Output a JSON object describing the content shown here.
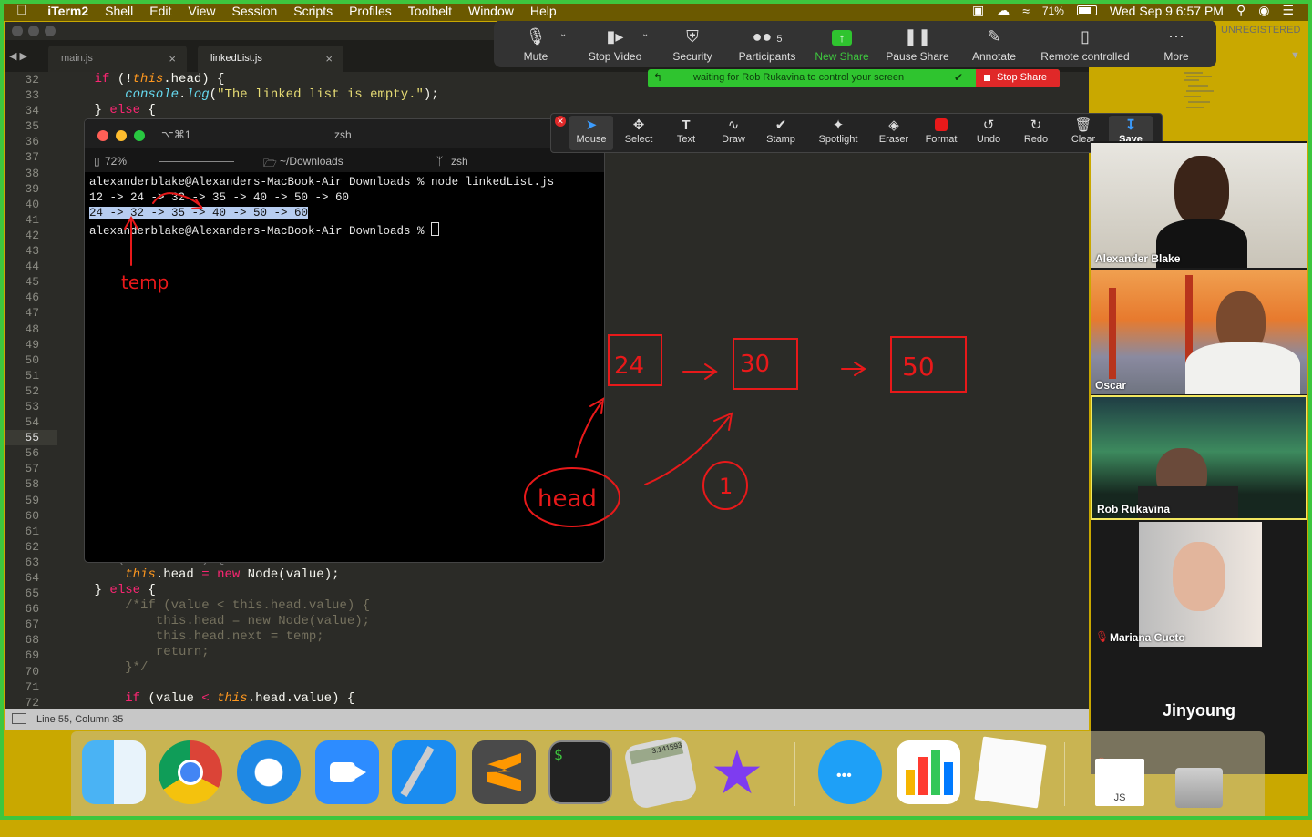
{
  "menubar": {
    "app": "iTerm2",
    "items": [
      "Shell",
      "Edit",
      "View",
      "Session",
      "Scripts",
      "Profiles",
      "Toolbelt",
      "Window",
      "Help"
    ],
    "battery": "71%",
    "clock": "Wed Sep 9  6:57 PM"
  },
  "editor": {
    "tabs": [
      {
        "label": "main.js",
        "close": "×"
      },
      {
        "label": "linkedList.js",
        "close": "×"
      }
    ],
    "unregistered": "UNREGISTERED",
    "line_numbers": [
      32,
      33,
      34,
      35,
      36,
      37,
      38,
      39,
      40,
      41,
      42,
      43,
      44,
      45,
      46,
      47,
      48,
      49,
      50,
      51,
      52,
      53,
      54,
      55,
      56,
      57,
      58,
      59,
      60,
      61,
      62,
      63,
      64,
      65,
      66,
      67,
      68,
      69,
      70,
      71,
      72
    ],
    "current_line": 55,
    "status": "Line 55, Column 35",
    "code_top": [
      {
        "line": 32,
        "text": "    if (!this.head) {"
      },
      {
        "line": 33,
        "text": "        console.log(\"The linked list is empty.\");"
      },
      {
        "line": 34,
        "text": "    } else {"
      }
    ],
    "code_bottom": [
      {
        "line": 64,
        "text": "        this.head = new Node(value);"
      },
      {
        "line": 65,
        "text": "    } else {"
      },
      {
        "line": 66,
        "text": "        /*if (value < this.head.value) {"
      },
      {
        "line": 67,
        "text": "            this.head = new Node(value);"
      },
      {
        "line": 68,
        "text": "            this.head.next = temp;"
      },
      {
        "line": 69,
        "text": "            return;"
      },
      {
        "line": 70,
        "text": "        }*/"
      },
      {
        "line": 72,
        "text": "        if (value < this.head.value) {"
      }
    ]
  },
  "terminal": {
    "title": "zsh",
    "shortcut": "⌥⌘1",
    "battery": "72%",
    "path": "~/Downloads",
    "shell": "zsh",
    "lines": [
      "alexanderblake@Alexanders-MacBook-Air Downloads % node linkedList.js",
      "12 -> 24 -> 32 -> 35 -> 40 -> 50 -> 60",
      "24 -> 32 -> 35 -> 40 -> 50 -> 60",
      "alexanderblake@Alexanders-MacBook-Air Downloads % "
    ]
  },
  "zoom_toolbar": {
    "buttons": [
      {
        "label": "Mute",
        "icon": "microphone-icon"
      },
      {
        "label": "Stop Video",
        "icon": "video-camera-icon"
      },
      {
        "label": "Security",
        "icon": "shield-icon"
      },
      {
        "label": "Participants",
        "icon": "participants-icon",
        "count": "5"
      },
      {
        "label": "New Share",
        "icon": "share-arrow-icon"
      },
      {
        "label": "Pause Share",
        "icon": "pause-icon"
      },
      {
        "label": "Annotate",
        "icon": "pencil-icon"
      },
      {
        "label": "Remote controlled",
        "icon": "mouse-icon"
      },
      {
        "label": "More",
        "icon": "ellipsis-icon"
      }
    ],
    "banner": "waiting for Rob Rukavina to control your screen",
    "stop_share": "Stop Share"
  },
  "annotate_toolbar": {
    "tools": [
      "Mouse",
      "Select",
      "Text",
      "Draw",
      "Stamp",
      "Spotlight",
      "Eraser",
      "Format",
      "Undo",
      "Redo",
      "Clear",
      "Save"
    ],
    "format_color": "#e8191a"
  },
  "participants": [
    {
      "name": "Alexander Blake",
      "muted": false
    },
    {
      "name": "Oscar",
      "muted": false
    },
    {
      "name": "Rob Rukavina",
      "muted": false,
      "speaking": true
    },
    {
      "name": "Mariana Cueto",
      "muted": true
    },
    {
      "name": "Jinyoung",
      "muted": true
    }
  ],
  "annotations": {
    "color": "#e8191a",
    "terminal_label": "temp",
    "boxes": [
      "24",
      "30",
      "50"
    ],
    "head_label": "head",
    "node_label": "1"
  },
  "dock": {
    "apps": [
      "finder-icon",
      "chrome-icon",
      "safari-icon",
      "zoom-icon",
      "xcode-icon",
      "sublime-text-icon",
      "terminal-icon",
      "calculator-icon",
      "imovie-icon",
      "messages-icon",
      "numbers-icon",
      "textedit-icon",
      "js-file-icon",
      "trash-icon"
    ],
    "calculator_display": "3.141593",
    "file_label": "JS"
  },
  "colors": {
    "accent_green": "#3ec63e",
    "menubar": "#6b5900",
    "desktop": "#c9a800"
  }
}
